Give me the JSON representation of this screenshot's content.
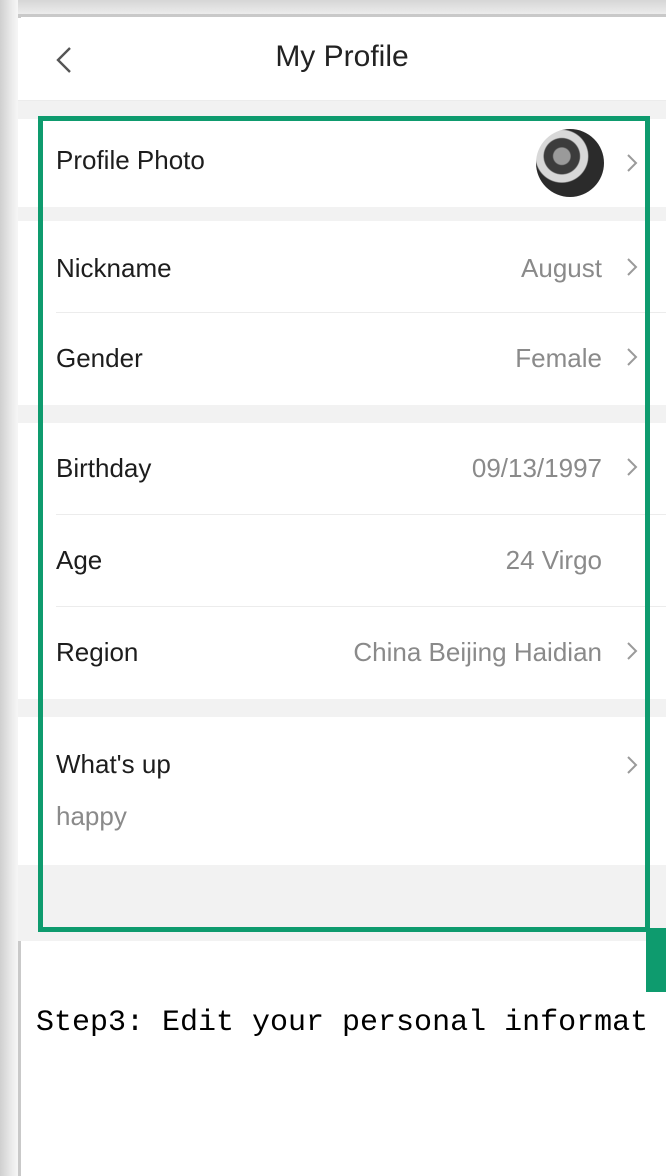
{
  "header": {
    "title": "My Profile"
  },
  "rows": {
    "profile_photo": {
      "label": "Profile Photo"
    },
    "nickname": {
      "label": "Nickname",
      "value": "August"
    },
    "gender": {
      "label": "Gender",
      "value": "Female"
    },
    "birthday": {
      "label": "Birthday",
      "value": "09/13/1997"
    },
    "age": {
      "label": "Age",
      "value": "24 Virgo"
    },
    "region": {
      "label": "Region",
      "value": "China Beijing Haidian"
    },
    "whats_up": {
      "label": "What's up",
      "value": "happy"
    }
  },
  "caption": "Step3: Edit your personal informat",
  "colors": {
    "highlight": "#0e9b6e",
    "label": "#1d1d1d",
    "value": "#8a8a8a"
  },
  "icons": [
    "back-arrow-icon",
    "chevron-right-icon"
  ]
}
